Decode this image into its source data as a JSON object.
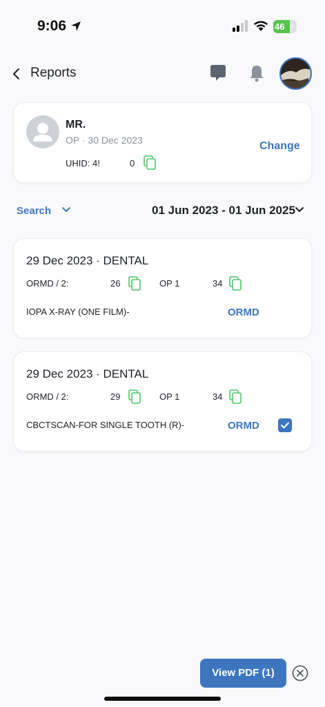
{
  "status_bar": {
    "time": "9:06",
    "battery": "46"
  },
  "header": {
    "title": "Reports"
  },
  "patient": {
    "name": "MR.",
    "subtitle": "OP · 30 Dec 2023",
    "uhid_label": "UHID: 4!",
    "uhid_tail": "0",
    "change_label": "Change"
  },
  "filter": {
    "search_label": "Search",
    "date_range": "01 Jun 2023 - 01 Jun 2025"
  },
  "reports": [
    {
      "title": "29 Dec 2023 · DENTAL",
      "ref1_prefix": "ORMD / 2:",
      "ref1_tail": "26",
      "ref2_prefix": "OP 1",
      "ref2_tail": "34",
      "description": "IOPA X-RAY (ONE FILM)-",
      "org": "ORMD",
      "selected": false
    },
    {
      "title": "29 Dec 2023 · DENTAL",
      "ref1_prefix": "ORMD / 2:",
      "ref1_tail": "29",
      "ref2_prefix": "OP 1",
      "ref2_tail": "34",
      "description": "CBCTSCAN-FOR SINGLE TOOTH (R)-",
      "org": "ORMD",
      "selected": true
    }
  ],
  "footer": {
    "view_pdf_label": "View PDF (1)"
  },
  "colors": {
    "accent": "#3d76bf",
    "copy_icon": "#4cc46a",
    "background": "#f9f9fb"
  }
}
